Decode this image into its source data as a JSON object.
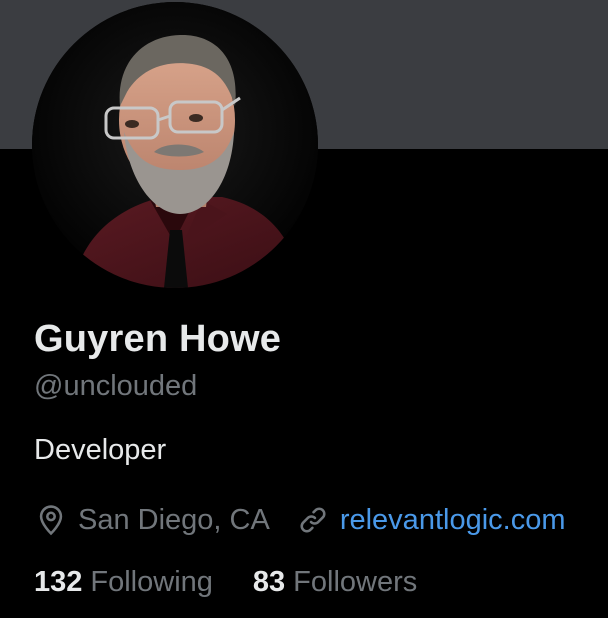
{
  "profile": {
    "name": "Guyren Howe",
    "handle": "@unclouded",
    "bio": "Developer",
    "location": "San Diego, CA",
    "website": "relevantlogic.com",
    "avatar_alt": "Profile photo of Guyren Howe"
  },
  "stats": {
    "following_count": "132",
    "following_label": "Following",
    "followers_count": "83",
    "followers_label": "Followers"
  },
  "icons": {
    "location": "location-pin-icon",
    "link": "link-icon"
  },
  "colors": {
    "background": "#000000",
    "banner": "#3b3d41",
    "primary_text": "#e7e9ea",
    "secondary_text": "#71767b",
    "link": "#4a99e9"
  }
}
